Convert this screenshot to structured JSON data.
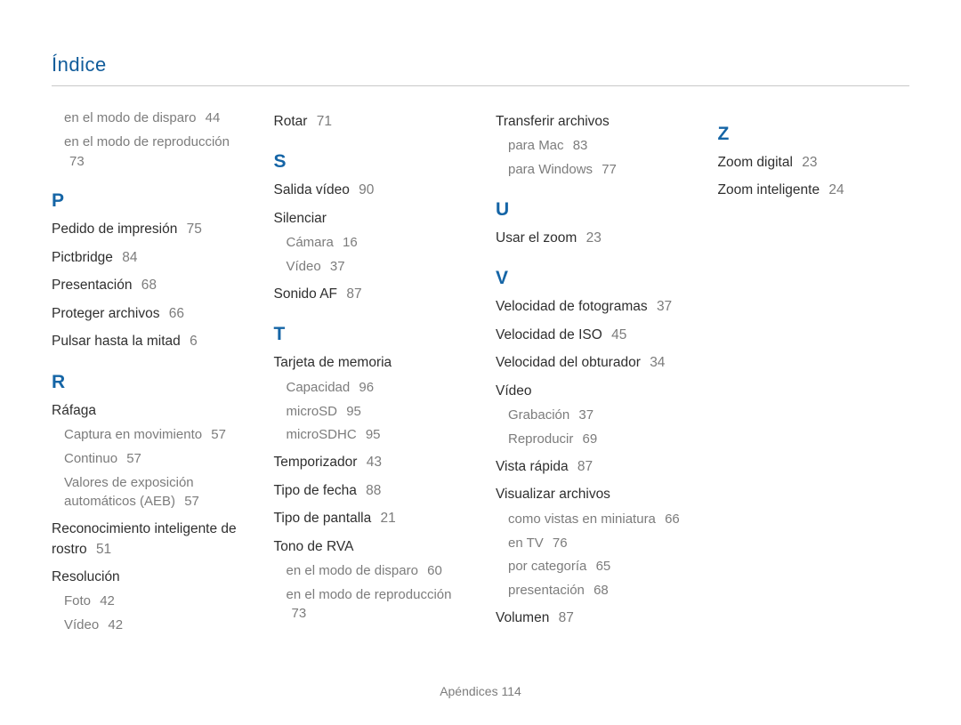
{
  "header": "Índice",
  "footer_label": "Apéndices",
  "footer_page": "114",
  "columns": [
    {
      "items": [
        {
          "type": "sub",
          "label": "en el modo de disparo",
          "page": "44"
        },
        {
          "type": "sub",
          "label": "en el modo de reproducción",
          "page": "73"
        },
        {
          "type": "letter",
          "label": "P"
        },
        {
          "type": "entry",
          "label": "Pedido de impresión",
          "page": "75"
        },
        {
          "type": "entry",
          "label": "Pictbridge",
          "page": "84"
        },
        {
          "type": "entry",
          "label": "Presentación",
          "page": "68"
        },
        {
          "type": "entry",
          "label": "Proteger archivos",
          "page": "66"
        },
        {
          "type": "entry",
          "label": "Pulsar hasta la mitad",
          "page": "6"
        },
        {
          "type": "letter",
          "label": "R"
        },
        {
          "type": "entry",
          "label": "Ráfaga",
          "page": ""
        },
        {
          "type": "sub",
          "label": "Captura en movimiento",
          "page": "57"
        },
        {
          "type": "sub",
          "label": "Continuo",
          "page": "57"
        },
        {
          "type": "sub",
          "label": "Valores de exposición automáticos (AEB)",
          "page": "57"
        },
        {
          "type": "entry",
          "label": "Reconocimiento inteligente de rostro",
          "page": "51"
        },
        {
          "type": "entry",
          "label": "Resolución",
          "page": ""
        },
        {
          "type": "sub",
          "label": "Foto",
          "page": "42"
        },
        {
          "type": "sub",
          "label": "Vídeo",
          "page": "42"
        }
      ]
    },
    {
      "items": [
        {
          "type": "entry",
          "label": "Rotar",
          "page": "71"
        },
        {
          "type": "letter",
          "label": "S"
        },
        {
          "type": "entry",
          "label": "Salida vídeo",
          "page": "90"
        },
        {
          "type": "entry",
          "label": "Silenciar",
          "page": ""
        },
        {
          "type": "sub",
          "label": "Cámara",
          "page": "16"
        },
        {
          "type": "sub",
          "label": "Vídeo",
          "page": "37"
        },
        {
          "type": "entry",
          "label": "Sonido AF",
          "page": "87"
        },
        {
          "type": "letter",
          "label": "T"
        },
        {
          "type": "entry",
          "label": "Tarjeta de memoria",
          "page": ""
        },
        {
          "type": "sub",
          "label": "Capacidad",
          "page": "96"
        },
        {
          "type": "sub",
          "label": "microSD",
          "page": "95"
        },
        {
          "type": "sub",
          "label": "microSDHC",
          "page": "95"
        },
        {
          "type": "entry",
          "label": "Temporizador",
          "page": "43"
        },
        {
          "type": "entry",
          "label": "Tipo de fecha",
          "page": "88"
        },
        {
          "type": "entry",
          "label": "Tipo de pantalla",
          "page": "21"
        },
        {
          "type": "entry",
          "label": "Tono de RVA",
          "page": ""
        },
        {
          "type": "sub",
          "label": "en el modo de disparo",
          "page": "60"
        },
        {
          "type": "sub",
          "label": "en el modo de reproducción",
          "page": "73"
        }
      ]
    },
    {
      "items": [
        {
          "type": "entry",
          "label": "Transferir archivos",
          "page": ""
        },
        {
          "type": "sub",
          "label": "para Mac",
          "page": "83"
        },
        {
          "type": "sub",
          "label": "para Windows",
          "page": "77"
        },
        {
          "type": "letter",
          "label": "U"
        },
        {
          "type": "entry",
          "label": "Usar el zoom",
          "page": "23"
        },
        {
          "type": "letter",
          "label": "V"
        },
        {
          "type": "entry",
          "label": "Velocidad de fotogramas",
          "page": "37"
        },
        {
          "type": "entry",
          "label": "Velocidad de ISO",
          "page": "45"
        },
        {
          "type": "entry",
          "label": "Velocidad del obturador",
          "page": "34"
        },
        {
          "type": "entry",
          "label": "Vídeo",
          "page": ""
        },
        {
          "type": "sub",
          "label": "Grabación",
          "page": "37"
        },
        {
          "type": "sub",
          "label": "Reproducir",
          "page": "69"
        },
        {
          "type": "entry",
          "label": "Vista rápida",
          "page": "87"
        },
        {
          "type": "entry",
          "label": "Visualizar archivos",
          "page": ""
        },
        {
          "type": "sub",
          "label": "como vistas en miniatura",
          "page": "66"
        },
        {
          "type": "sub",
          "label": "en TV",
          "page": "76"
        },
        {
          "type": "sub",
          "label": "por categoría",
          "page": "65"
        },
        {
          "type": "sub",
          "label": "presentación",
          "page": "68"
        },
        {
          "type": "entry",
          "label": "Volumen",
          "page": "87"
        }
      ]
    },
    {
      "items": [
        {
          "type": "letter",
          "label": "Z"
        },
        {
          "type": "entry",
          "label": "Zoom digital",
          "page": "23"
        },
        {
          "type": "entry",
          "label": "Zoom inteligente",
          "page": "24"
        }
      ]
    }
  ]
}
